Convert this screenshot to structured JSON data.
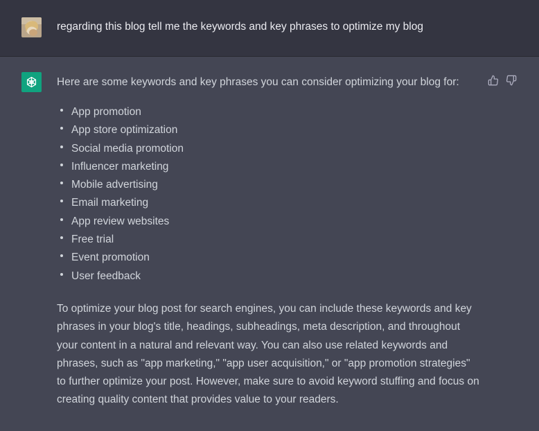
{
  "user_message": {
    "text": "regarding this blog tell me the keywords and key phrases to optimize my blog"
  },
  "assistant_message": {
    "intro": "Here are some keywords and key phrases you can consider optimizing your blog for:",
    "keywords": [
      "App promotion",
      "App store optimization",
      "Social media promotion",
      "Influencer marketing",
      "Mobile advertising",
      "Email marketing",
      "App review websites",
      "Free trial",
      "Event promotion",
      "User feedback"
    ],
    "summary": "To optimize your blog post for search engines, you can include these keywords and key phrases in your blog's title, headings, subheadings, meta description, and throughout your content in a natural and relevant way. You can also use related keywords and phrases, such as \"app marketing,\" \"app user acquisition,\" or \"app promotion strategies\" to further optimize your post. However, make sure to avoid keyword stuffing and focus on creating quality content that provides value to your readers."
  },
  "icons": {
    "bot_avatar": "openai-logo-icon",
    "thumbs_up": "thumbs-up-icon",
    "thumbs_down": "thumbs-down-icon"
  },
  "colors": {
    "user_bg": "#343541",
    "assistant_bg": "#444654",
    "bot_avatar_bg": "#10a37f"
  }
}
